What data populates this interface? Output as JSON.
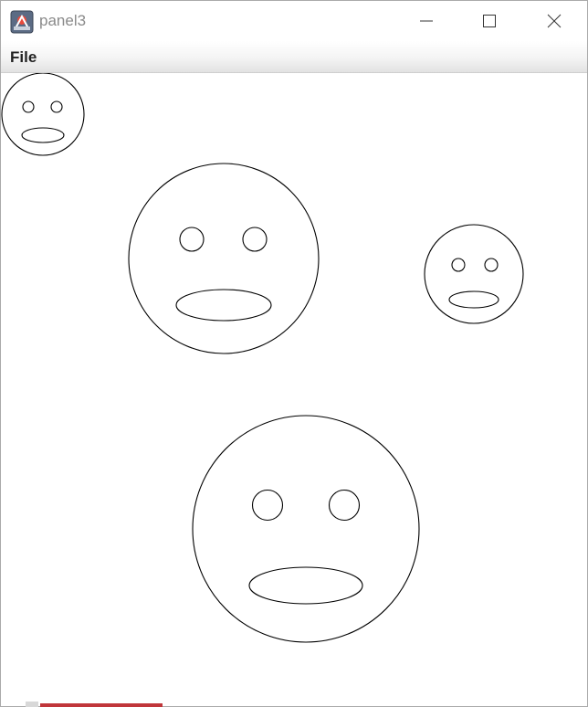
{
  "window": {
    "title": "panel3"
  },
  "titlebar": {
    "icon": "java-app-icon",
    "buttons": [
      "minimize-icon",
      "maximize-icon",
      "close-icon"
    ]
  },
  "menubar": {
    "items": [
      {
        "label": "File"
      }
    ]
  },
  "canvas": {
    "faces_count": 4,
    "stroke_color": "#000000",
    "background": "#ffffff"
  }
}
